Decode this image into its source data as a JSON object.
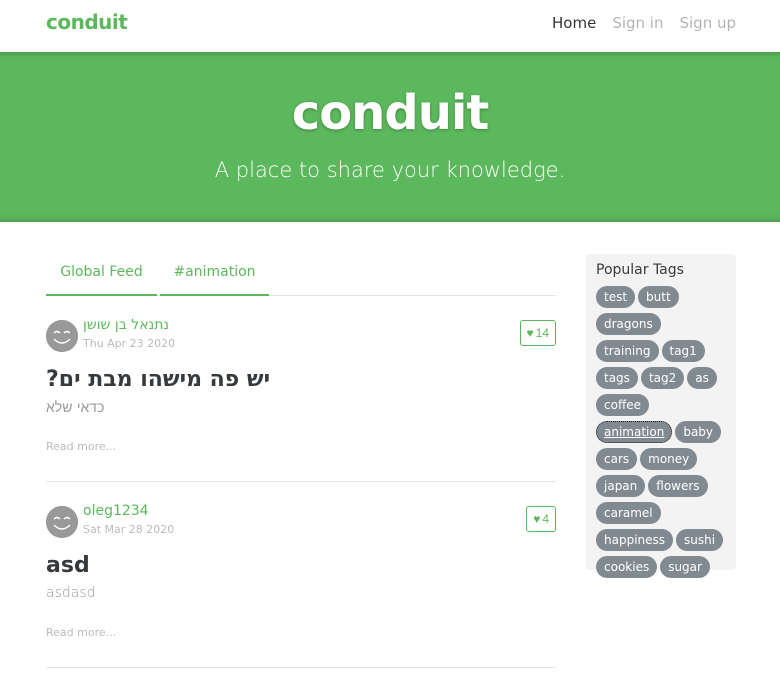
{
  "navbar": {
    "brand": "conduit",
    "links": [
      "Home",
      "Sign in",
      "Sign up"
    ]
  },
  "banner": {
    "title": "conduit",
    "subtitle": "A place to share your knowledge."
  },
  "feed": {
    "tabs": [
      "Global Feed",
      "#animation"
    ]
  },
  "articles": [
    {
      "author": "נתנאל בן שושן",
      "date": "Thu Apr 23 2020",
      "likes": "14",
      "title": "יש פה מישהו מבת ים?",
      "description": "כדאי שלא",
      "read_more": "Read more..."
    },
    {
      "author": "oleg1234",
      "date": "Sat Mar 28 2020",
      "likes": "4",
      "title": "asd",
      "description": "asdasd",
      "read_more": "Read more..."
    }
  ],
  "sidebar": {
    "title": "Popular Tags",
    "tags": [
      "test",
      "butt",
      "dragons",
      "training",
      "tag1",
      "tags",
      "tag2",
      "as",
      "coffee",
      "animation",
      "baby",
      "cars",
      "money",
      "japan",
      "flowers",
      "caramel",
      "happiness",
      "sushi",
      "cookies",
      "sugar"
    ],
    "focused_tag": "animation"
  },
  "colors": {
    "brand_green": "#5cb85c",
    "tag_gray": "#818a91",
    "sidebar_bg": "#f3f3f3"
  }
}
